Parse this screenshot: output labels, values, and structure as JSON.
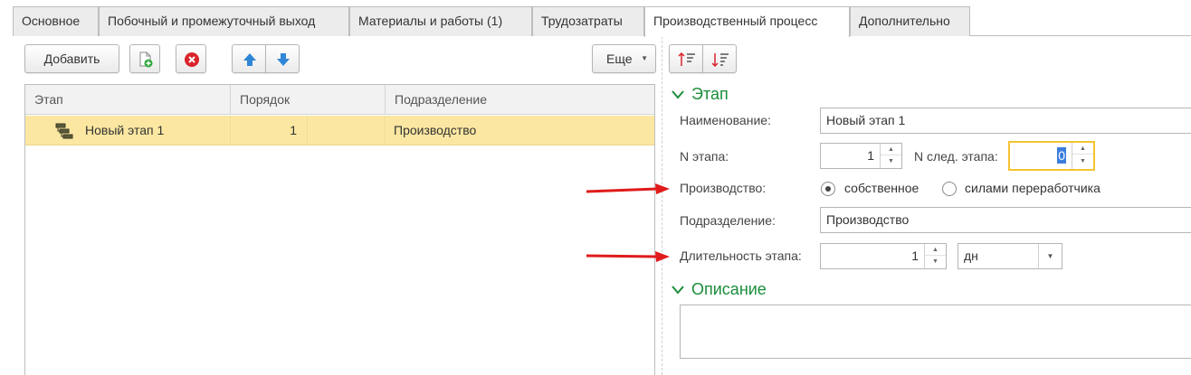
{
  "tabs": [
    {
      "label": "Основное"
    },
    {
      "label": "Побочный и промежуточный выход"
    },
    {
      "label": "Материалы и работы (1)"
    },
    {
      "label": "Трудозатраты"
    },
    {
      "label": "Производственный процесс"
    },
    {
      "label": "Дополнительно"
    }
  ],
  "active_tab": "Производственный процесс",
  "toolbar": {
    "add_label": "Добавить",
    "more_label": "Еще",
    "icons": [
      "add-copy-icon",
      "delete-icon",
      "move-up-icon",
      "move-down-icon"
    ]
  },
  "table": {
    "columns": [
      "Этап",
      "Порядок",
      "Подразделение"
    ],
    "rows": [
      {
        "stage": "Новый этап 1",
        "order": "1",
        "division": "Производство",
        "selected": true
      }
    ]
  },
  "stage_section": {
    "title": "Этап",
    "name_label": "Наименование:",
    "name_value": "Новый этап 1",
    "n_label": "N этапа:",
    "n_value": "1",
    "next_label": "N след. этапа:",
    "next_value": "0",
    "production_label": "Производство:",
    "production_options": [
      "собственное",
      "силами переработчика"
    ],
    "production_selected": "собственное",
    "division_label": "Подразделение:",
    "division_value": "Производство",
    "duration_label": "Длительность этапа:",
    "duration_value": "1",
    "duration_unit": "дн"
  },
  "description_section": {
    "title": "Описание",
    "value": ""
  },
  "colors": {
    "accent_green": "#1a8d3a",
    "selected_row": "#fbe7a1",
    "focus_border": "#f4c430",
    "annotation_arrow": "#e01b1b"
  }
}
